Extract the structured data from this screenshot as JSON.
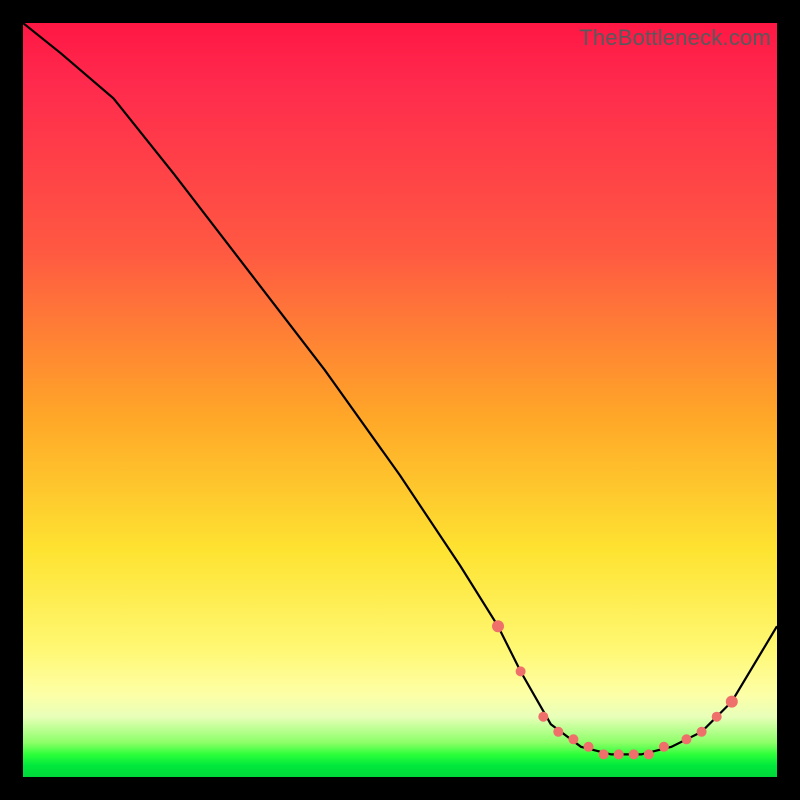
{
  "watermark": "TheBottleneck.com",
  "chart_data": {
    "type": "line",
    "title": "",
    "xlabel": "",
    "ylabel": "",
    "xlim": [
      0,
      100
    ],
    "ylim": [
      0,
      100
    ],
    "grid": false,
    "legend": false,
    "series": [
      {
        "name": "curve",
        "color": "#000000",
        "x": [
          0,
          5,
          12,
          20,
          30,
          40,
          50,
          58,
          63,
          66,
          70,
          74,
          78,
          82,
          86,
          90,
          94,
          100
        ],
        "y": [
          100,
          96,
          90,
          80,
          67,
          54,
          40,
          28,
          20,
          14,
          7,
          4,
          3,
          3,
          4,
          6,
          10,
          20
        ]
      }
    ],
    "markers": {
      "name": "highlighted-points",
      "color": "#ef6f6a",
      "x": [
        63,
        66,
        69,
        71,
        73,
        75,
        77,
        79,
        81,
        83,
        85,
        88,
        90,
        92,
        94
      ],
      "y": [
        20,
        14,
        8,
        6,
        5,
        4,
        3,
        3,
        3,
        3,
        4,
        5,
        6,
        8,
        10
      ]
    }
  }
}
